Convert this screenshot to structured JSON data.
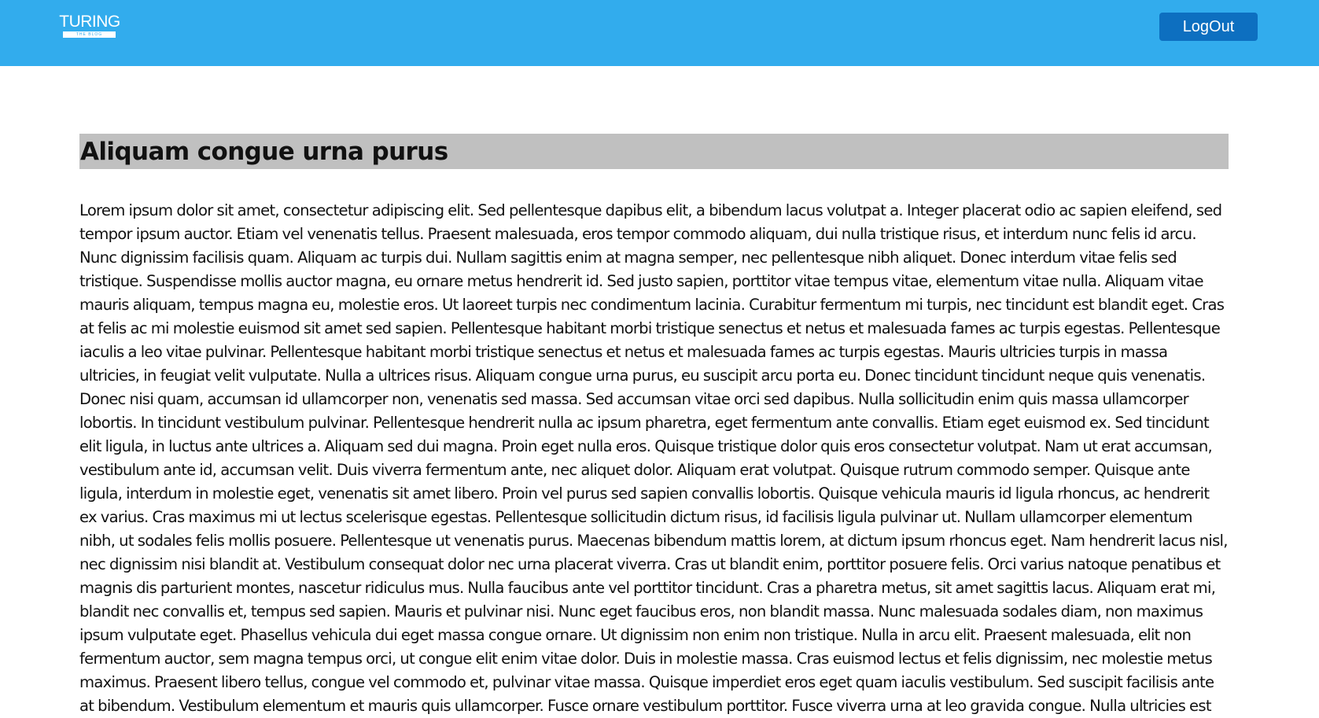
{
  "header": {
    "logo_title": "TURING",
    "logo_subtitle": "THE BLOG",
    "logout_label": "LogOut",
    "background_color": "#32aced",
    "button_color": "#0d6fc0"
  },
  "post": {
    "title": "Aliquam congue urna purus",
    "body": "Lorem ipsum dolor sit amet, consectetur adipiscing elit. Sed pellentesque dapibus elit, a bibendum lacus volutpat a. Integer placerat odio ac sapien eleifend, sed tempor ipsum auctor. Etiam vel venenatis tellus. Praesent malesuada, eros tempor commodo aliquam, dui nulla tristique risus, et interdum nunc felis id arcu. Nunc dignissim facilisis quam. Aliquam ac turpis dui. Nullam sagittis enim at magna semper, nec pellentesque nibh aliquet. Donec interdum vitae felis sed tristique. Suspendisse mollis auctor magna, eu ornare metus hendrerit id. Sed justo sapien, porttitor vitae tempus vitae, elementum vitae nulla. Aliquam vitae mauris aliquam, tempus magna eu, molestie eros. Ut laoreet turpis nec condimentum lacinia. Curabitur fermentum mi turpis, nec tincidunt est blandit eget. Cras at felis ac mi molestie euismod sit amet sed sapien. Pellentesque habitant morbi tristique senectus et netus et malesuada fames ac turpis egestas. Pellentesque iaculis a leo vitae pulvinar. Pellentesque habitant morbi tristique senectus et netus et malesuada fames ac turpis egestas. Mauris ultricies turpis in massa ultricies, in feugiat velit vulputate. Nulla a ultrices risus. Aliquam congue urna purus, eu suscipit arcu porta eu. Donec tincidunt tincidunt neque quis venenatis. Donec nisi quam, accumsan id ullamcorper non, venenatis sed massa. Sed accumsan vitae orci sed dapibus. Nulla sollicitudin enim quis massa ullamcorper lobortis. In tincidunt vestibulum pulvinar. Pellentesque hendrerit nulla ac ipsum pharetra, eget fermentum ante convallis. Etiam eget euismod ex. Sed tincidunt elit ligula, in luctus ante ultrices a. Aliquam sed dui magna. Proin eget nulla eros. Quisque tristique dolor quis eros consectetur volutpat. Nam ut erat accumsan, vestibulum ante id, accumsan velit. Duis viverra fermentum ante, nec aliquet dolor. Aliquam erat volutpat. Quisque rutrum commodo semper. Quisque ante ligula, interdum in molestie eget, venenatis sit amet libero. Proin vel purus sed sapien convallis lobortis. Quisque vehicula mauris id ligula rhoncus, ac hendrerit ex varius. Cras maximus mi ut lectus scelerisque egestas. Pellentesque sollicitudin dictum risus, id facilisis ligula pulvinar ut. Nullam ullamcorper elementum nibh, ut sodales felis mollis posuere. Pellentesque ut venenatis purus. Maecenas bibendum mattis lorem, at dictum ipsum rhoncus eget. Nam hendrerit lacus nisl, nec dignissim nisi blandit at. Vestibulum consequat dolor nec urna placerat viverra. Cras ut blandit enim, porttitor posuere felis. Orci varius natoque penatibus et magnis dis parturient montes, nascetur ridiculus mus. Nulla faucibus ante vel porttitor tincidunt. Cras a pharetra metus, sit amet sagittis lacus. Aliquam erat mi, blandit nec convallis et, tempus sed sapien. Mauris et pulvinar nisi. Nunc eget faucibus eros, non blandit massa. Nunc malesuada sodales diam, non maximus ipsum vulputate eget. Phasellus vehicula dui eget massa congue ornare. Ut dignissim non enim non tristique. Nulla in arcu elit. Praesent malesuada, elit non fermentum auctor, sem magna tempus orci, ut congue elit enim vitae dolor. Duis in molestie massa. Cras euismod lectus et felis dignissim, nec molestie metus maximus. Praesent libero tellus, congue vel commodo et, pulvinar vitae massa. Quisque imperdiet eros eget quam iaculis vestibulum. Sed suscipit facilisis ante at bibendum. Vestibulum elementum et mauris quis ullamcorper. Fusce ornare vestibulum porttitor. Fusce viverra urna at leo gravida congue. Nulla ultricies est"
  }
}
